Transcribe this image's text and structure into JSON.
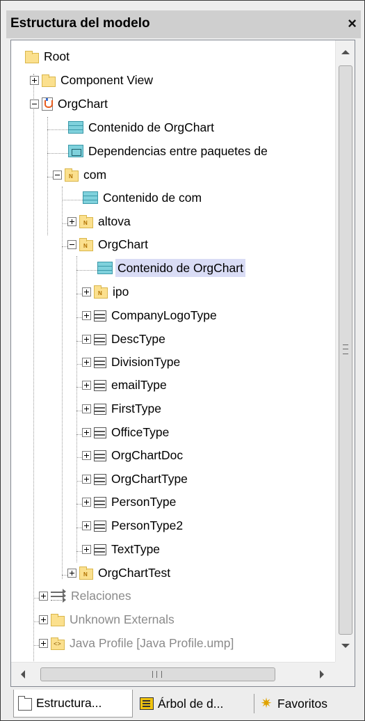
{
  "panel": {
    "title": "Estructura del modelo",
    "close_glyph": "×"
  },
  "tree": {
    "items": [
      {
        "label": "Root",
        "icon": "folder-icon"
      },
      {
        "label": "Component View",
        "icon": "folder-icon"
      },
      {
        "label": "OrgChart",
        "icon": "java-project-icon"
      },
      {
        "label": "Contenido de OrgChart",
        "icon": "diagram-icon"
      },
      {
        "label": "Dependencias entre paquetes de",
        "icon": "package-dependency-diagram-icon"
      },
      {
        "label": "com",
        "icon": "package-icon"
      },
      {
        "label": "Contenido de com",
        "icon": "diagram-icon"
      },
      {
        "label": "altova",
        "icon": "package-icon"
      },
      {
        "label": "OrgChart",
        "icon": "package-icon"
      },
      {
        "label": "Contenido de OrgChart",
        "icon": "diagram-icon",
        "selected": true
      },
      {
        "label": "ipo",
        "icon": "package-icon"
      },
      {
        "label": "CompanyLogoType",
        "icon": "class-icon"
      },
      {
        "label": "DescType",
        "icon": "class-icon"
      },
      {
        "label": "DivisionType",
        "icon": "class-icon"
      },
      {
        "label": "emailType",
        "icon": "class-icon"
      },
      {
        "label": "FirstType",
        "icon": "class-icon"
      },
      {
        "label": "OfficeType",
        "icon": "class-icon"
      },
      {
        "label": "OrgChartDoc",
        "icon": "class-icon"
      },
      {
        "label": "OrgChartType",
        "icon": "class-icon"
      },
      {
        "label": "PersonType",
        "icon": "class-icon"
      },
      {
        "label": "PersonType2",
        "icon": "class-icon"
      },
      {
        "label": "TextType",
        "icon": "class-icon"
      },
      {
        "label": "OrgChartTest",
        "icon": "package-icon"
      },
      {
        "label": "Relaciones",
        "icon": "relations-icon"
      },
      {
        "label": "Unknown Externals",
        "icon": "folder-icon"
      },
      {
        "label": "Java Profile [Java Profile.ump]",
        "icon": "profile-icon"
      }
    ]
  },
  "scrollbars": {
    "up": "▲",
    "down": "▼",
    "left": "◀",
    "right": "▶"
  },
  "tabs": [
    {
      "label": "Estructura...",
      "icon": "folder-outline-icon",
      "active": true
    },
    {
      "label": "Árbol de d...",
      "icon": "hierarchy-tree-icon"
    },
    {
      "label": "Favoritos",
      "icon": "star-icon"
    }
  ]
}
